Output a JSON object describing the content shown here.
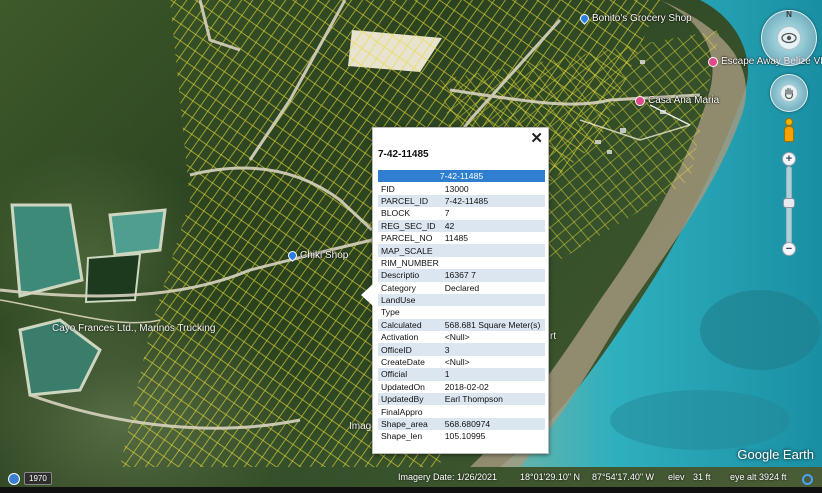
{
  "map": {
    "places": [
      {
        "name": "Bonito's Grocery Shop",
        "pin": "blue"
      },
      {
        "name": "Escape Away Belize VRBO",
        "pin": "pink"
      },
      {
        "name": "Casa Ana Maria",
        "pin": "pink"
      },
      {
        "name": "Chiki Shop",
        "pin": "blue"
      }
    ],
    "labels": {
      "cayo": "Cayo Frances Ltd., Marinos Trucking",
      "partial_rt": "rt",
      "partial_imag": "Imag"
    }
  },
  "controls": {
    "compass_north": "N",
    "compass_icon": "eye-compass-icon",
    "look_icon": "hand-pan-icon",
    "pegman_icon": "street-view-pegman-icon",
    "zoom_in": "+",
    "zoom_out": "−"
  },
  "popup": {
    "title": "7-42-11485",
    "close_label": "✕",
    "header_value": "7-42-11485",
    "rows": [
      {
        "key": "FID",
        "value": "13000"
      },
      {
        "key": "PARCEL_ID",
        "value": "7-42-11485"
      },
      {
        "key": "BLOCK",
        "value": "7"
      },
      {
        "key": "REG_SEC_ID",
        "value": "42"
      },
      {
        "key": "PARCEL_NO",
        "value": "11485"
      },
      {
        "key": "MAP_SCALE",
        "value": ""
      },
      {
        "key": "RIM_NUMBER",
        "value": ""
      },
      {
        "key": "Descriptio",
        "value": "16367 7"
      },
      {
        "key": "Category",
        "value": "Declared"
      },
      {
        "key": "LandUse",
        "value": ""
      },
      {
        "key": "Type",
        "value": ""
      },
      {
        "key": "Calculated",
        "value": "568.681 Square Meter(s)"
      },
      {
        "key": "Activation",
        "value": "<Null>"
      },
      {
        "key": "OfficeID",
        "value": "3"
      },
      {
        "key": "CreateDate",
        "value": "<Null>"
      },
      {
        "key": "Official",
        "value": "1"
      },
      {
        "key": "UpdatedOn",
        "value": "2018-02-02"
      },
      {
        "key": "UpdatedBy",
        "value": "Earl Thompson"
      },
      {
        "key": "FinalAppro",
        "value": ""
      },
      {
        "key": "Shape_area",
        "value": "568.680974"
      },
      {
        "key": "Shape_len",
        "value": "105.10995"
      }
    ]
  },
  "status": {
    "year": "1970",
    "imagery_date": "Imagery Date: 1/26/2021",
    "lat": "18°01'29.10\" N",
    "lon": "87°54'17.40\" W",
    "elev_label": "elev",
    "elev_value": "31 ft",
    "eye_alt": "eye alt  3924 ft"
  },
  "logo": "Google Earth",
  "colors": {
    "popup_header": "#2e7fd0",
    "popup_stripe": "#dce6f1",
    "parcel_lines": "#e8e23a",
    "sea": "#2aa6b4"
  }
}
